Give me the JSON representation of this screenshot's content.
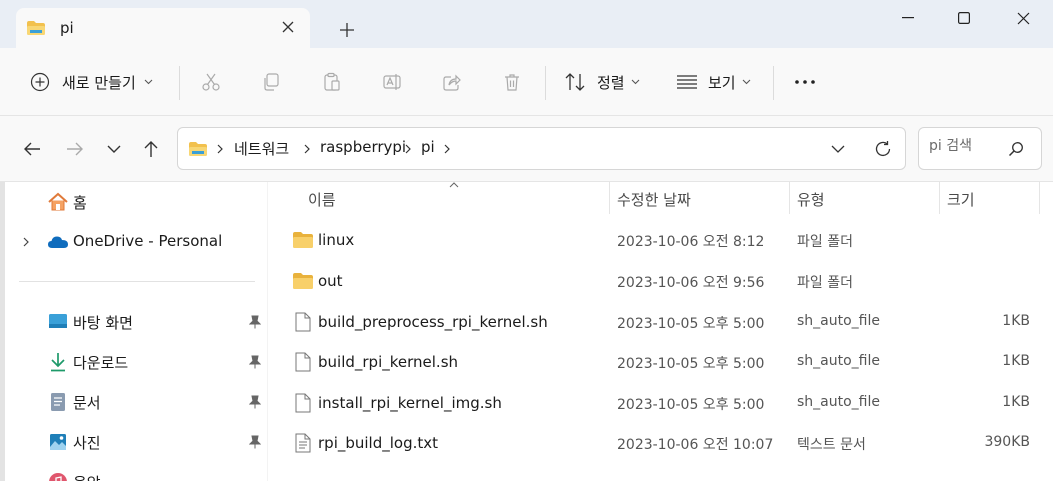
{
  "window": {
    "tab_title": "pi",
    "tab_close_glyph": "✕",
    "new_tab_glyph": "+",
    "minimize_glyph": "—",
    "close_glyph": "✕"
  },
  "toolbar": {
    "new_label": "새로 만들기",
    "sort_label": "정렬",
    "view_label": "보기",
    "more_glyph": "•••"
  },
  "address": {
    "breadcrumbs": [
      "네트워크",
      "raspberrypi",
      "pi"
    ]
  },
  "search": {
    "placeholder": "pi 검색"
  },
  "sidebar": {
    "items": [
      {
        "label": "홈",
        "icon": "home-icon"
      },
      {
        "label": "OneDrive - Personal",
        "icon": "cloud-icon"
      },
      {
        "label": "바탕 화면",
        "icon": "desktop-icon"
      },
      {
        "label": "다운로드",
        "icon": "download-icon"
      },
      {
        "label": "문서",
        "icon": "document-icon"
      },
      {
        "label": "사진",
        "icon": "picture-icon"
      },
      {
        "label": "음악",
        "icon": "music-icon"
      }
    ]
  },
  "columns": {
    "name": "이름",
    "date": "수정한 날짜",
    "type": "유형",
    "size": "크기"
  },
  "files": [
    {
      "name": "linux",
      "date": "2023-10-06 오전 8:12",
      "type": "파일 폴더",
      "size": "",
      "kind": "folder"
    },
    {
      "name": "out",
      "date": "2023-10-06 오전 9:56",
      "type": "파일 폴더",
      "size": "",
      "kind": "folder"
    },
    {
      "name": "build_preprocess_rpi_kernel.sh",
      "date": "2023-10-05 오후 5:00",
      "type": "sh_auto_file",
      "size": "1KB",
      "kind": "file"
    },
    {
      "name": "build_rpi_kernel.sh",
      "date": "2023-10-05 오후 5:00",
      "type": "sh_auto_file",
      "size": "1KB",
      "kind": "file"
    },
    {
      "name": "install_rpi_kernel_img.sh",
      "date": "2023-10-05 오후 5:00",
      "type": "sh_auto_file",
      "size": "1KB",
      "kind": "file"
    },
    {
      "name": "rpi_build_log.txt",
      "date": "2023-10-06 오전 10:07",
      "type": "텍스트 문서",
      "size": "390KB",
      "kind": "text"
    }
  ],
  "colors": {
    "folder": "#f2c14e",
    "accent": "#0067c0"
  }
}
